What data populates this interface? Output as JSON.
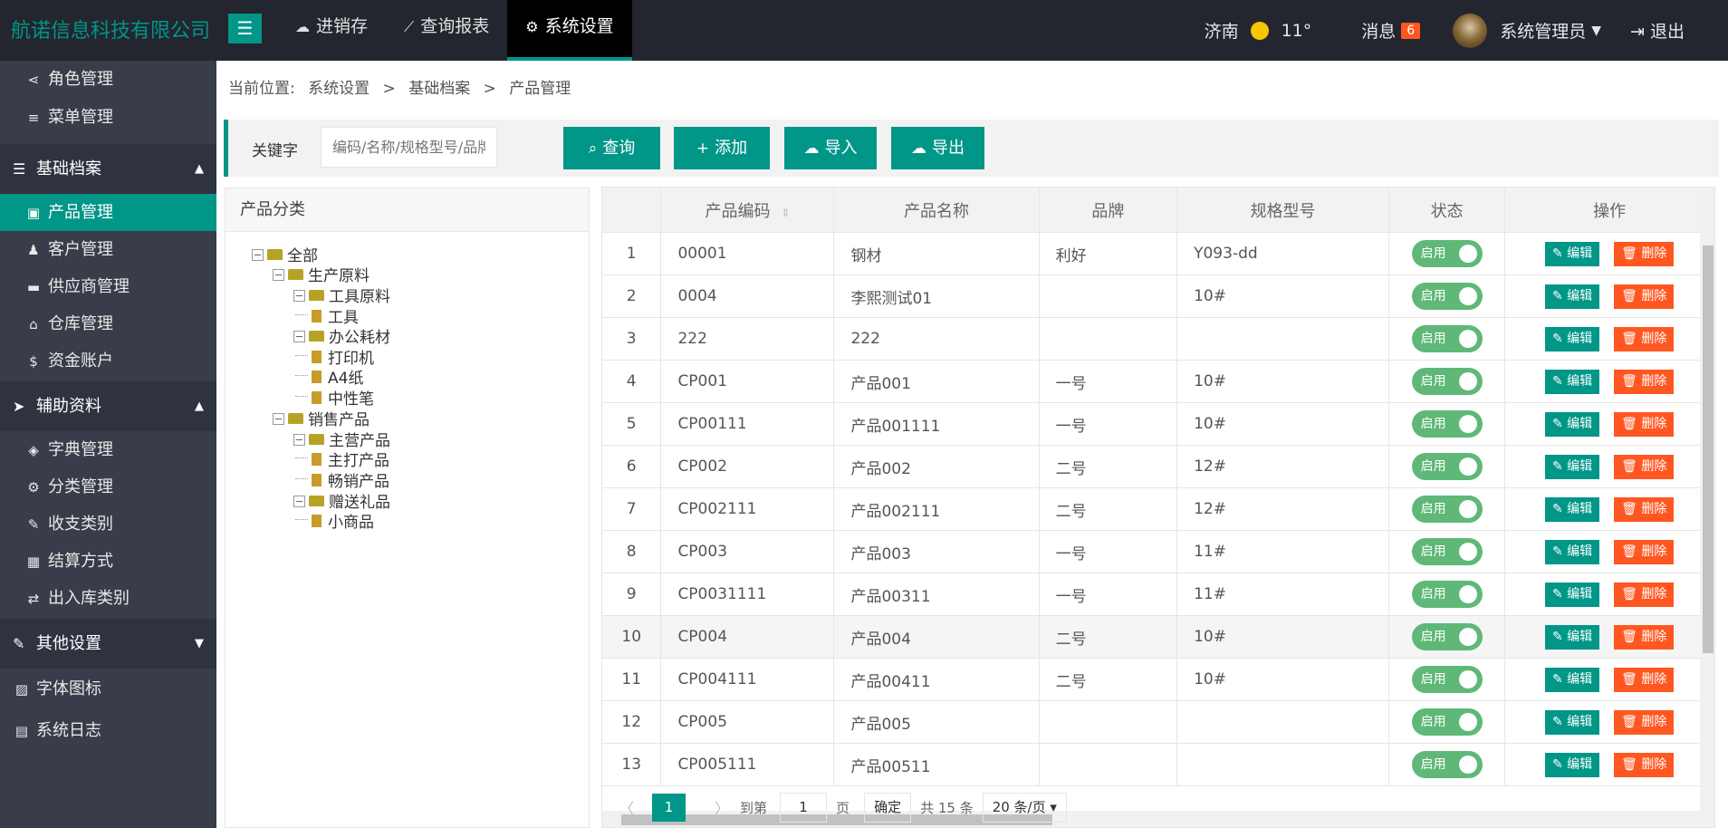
{
  "app": {
    "brand": "航诺信息科技有限公司"
  },
  "topnav": [
    {
      "label": "进销存",
      "icon": "cloud-icon"
    },
    {
      "label": "查询报表",
      "icon": "line-chart-icon"
    },
    {
      "label": "系统设置",
      "icon": "gears-icon",
      "active": true
    }
  ],
  "header": {
    "city": "济南",
    "temperature": "11°",
    "messages_label": "消息",
    "messages_count": "6",
    "user_name": "系统管理员",
    "logout_label": "退出"
  },
  "sidebar": {
    "items_top": [
      {
        "label": "角色管理",
        "icon": "share-icon"
      },
      {
        "label": "菜单管理",
        "icon": "menu-icon"
      }
    ],
    "groups": [
      {
        "label": "基础档案",
        "icon": "list-icon",
        "expanded": true,
        "items": [
          {
            "label": "产品管理",
            "icon": "shopping-bag-icon",
            "active": true
          },
          {
            "label": "客户管理",
            "icon": "users-icon"
          },
          {
            "label": "供应商管理",
            "icon": "truck-icon"
          },
          {
            "label": "仓库管理",
            "icon": "home-icon"
          },
          {
            "label": "资金账户",
            "icon": "dollar-icon"
          }
        ]
      },
      {
        "label": "辅助资料",
        "icon": "paper-plane-icon",
        "expanded": true,
        "items": [
          {
            "label": "字典管理",
            "icon": "layers-icon"
          },
          {
            "label": "分类管理",
            "icon": "gears-icon"
          },
          {
            "label": "收支类别",
            "icon": "edit-icon"
          },
          {
            "label": "结算方式",
            "icon": "calculator-icon"
          },
          {
            "label": "出入库类别",
            "icon": "exchange-icon"
          }
        ]
      },
      {
        "label": "其他设置",
        "icon": "edit-icon",
        "expanded": false,
        "items": []
      }
    ],
    "items_bottom": [
      {
        "label": "字体图标",
        "icon": "image-icon"
      },
      {
        "label": "系统日志",
        "icon": "log-icon"
      }
    ]
  },
  "breadcrumb": {
    "prefix": "当前位置:",
    "items": [
      "系统设置",
      "基础档案",
      "产品管理"
    ],
    "separator": ">"
  },
  "search": {
    "label": "关键字",
    "placeholder": "编码/名称/规格型号/品牌",
    "query_label": "查询",
    "add_label": "添加",
    "import_label": "导入",
    "export_label": "导出"
  },
  "category_panel": {
    "title": "产品分类",
    "tree": [
      {
        "label": "全部",
        "level": 0,
        "type": "folder"
      },
      {
        "label": "生产原料",
        "level": 1,
        "type": "folder"
      },
      {
        "label": "工具原料",
        "level": 2,
        "type": "folder"
      },
      {
        "label": "工具",
        "level": 3,
        "type": "file"
      },
      {
        "label": "办公耗材",
        "level": 2,
        "type": "folder"
      },
      {
        "label": "打印机",
        "level": 3,
        "type": "file"
      },
      {
        "label": "A4纸",
        "level": 3,
        "type": "file"
      },
      {
        "label": "中性笔",
        "level": 3,
        "type": "file"
      },
      {
        "label": "销售产品",
        "level": 1,
        "type": "folder"
      },
      {
        "label": "主营产品",
        "level": 2,
        "type": "folder"
      },
      {
        "label": "主打产品",
        "level": 3,
        "type": "file"
      },
      {
        "label": "畅销产品",
        "level": 3,
        "type": "file"
      },
      {
        "label": "赠送礼品",
        "level": 2,
        "type": "folder"
      },
      {
        "label": "小商品",
        "level": 3,
        "type": "file"
      }
    ]
  },
  "table": {
    "columns": [
      "",
      "产品编码",
      "产品名称",
      "品牌",
      "规格型号",
      "状态",
      "操作"
    ],
    "status_label": "启用",
    "edit_label": "编辑",
    "delete_label": "删除",
    "rows": [
      {
        "no": "1",
        "code": "00001",
        "name": "钢材",
        "brand": "利好",
        "spec": "Y093-dd"
      },
      {
        "no": "2",
        "code": "0004",
        "name": "李熙测试01",
        "brand": "",
        "spec": "10#"
      },
      {
        "no": "3",
        "code": "222",
        "name": "222",
        "brand": "",
        "spec": ""
      },
      {
        "no": "4",
        "code": "CP001",
        "name": "产品001",
        "brand": "一号",
        "spec": "10#"
      },
      {
        "no": "5",
        "code": "CP00111",
        "name": "产品001111",
        "brand": "一号",
        "spec": "10#"
      },
      {
        "no": "6",
        "code": "CP002",
        "name": "产品002",
        "brand": "二号",
        "spec": "12#"
      },
      {
        "no": "7",
        "code": "CP002111",
        "name": "产品002111",
        "brand": "二号",
        "spec": "12#"
      },
      {
        "no": "8",
        "code": "CP003",
        "name": "产品003",
        "brand": "一号",
        "spec": "11#"
      },
      {
        "no": "9",
        "code": "CP0031111",
        "name": "产品00311",
        "brand": "一号",
        "spec": "11#"
      },
      {
        "no": "10",
        "code": "CP004",
        "name": "产品004",
        "brand": "二号",
        "spec": "10#",
        "highlight": true
      },
      {
        "no": "11",
        "code": "CP004111",
        "name": "产品00411",
        "brand": "二号",
        "spec": "10#"
      },
      {
        "no": "12",
        "code": "CP005",
        "name": "产品005",
        "brand": "",
        "spec": ""
      },
      {
        "no": "13",
        "code": "CP005111",
        "name": "产品00511",
        "brand": "",
        "spec": ""
      }
    ]
  },
  "pager": {
    "current_page": "1",
    "goto_label": "到第",
    "goto_value": "1",
    "page_label": "页",
    "confirm_label": "确定",
    "total_label": "共 15 条",
    "page_size_label": "20 条/页"
  },
  "colors": {
    "accent": "#009688",
    "danger": "#ff5722",
    "switch_on": "#5fb878",
    "sidebar": "#393d49",
    "topbar": "#23262e"
  }
}
